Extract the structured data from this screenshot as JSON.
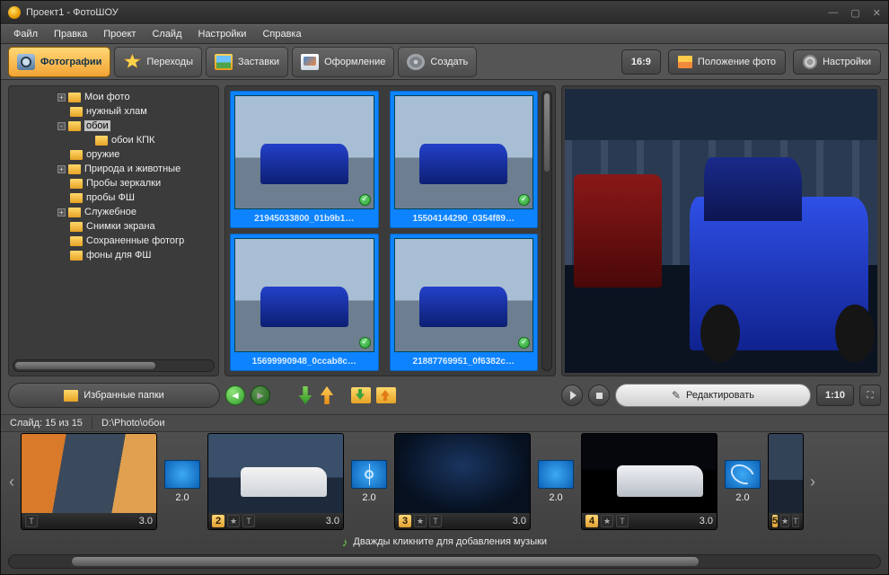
{
  "title": "Проект1 - ФотоШОУ",
  "menu": [
    "Файл",
    "Правка",
    "Проект",
    "Слайд",
    "Настройки",
    "Справка"
  ],
  "tabs": {
    "photos": "Фотографии",
    "transitions": "Переходы",
    "titles": "Заставки",
    "design": "Оформление",
    "create": "Создать"
  },
  "rtool": {
    "aspect": "16:9",
    "position": "Положение фото",
    "settings": "Настройки"
  },
  "tree": [
    {
      "indent": 50,
      "exp": "+",
      "label": "Мои фото"
    },
    {
      "indent": 50,
      "exp": "",
      "label": "нужный хлам"
    },
    {
      "indent": 50,
      "exp": "-",
      "label": "обои",
      "sel": true
    },
    {
      "indent": 78,
      "exp": "",
      "label": "обои КПК"
    },
    {
      "indent": 50,
      "exp": "",
      "label": "оружие"
    },
    {
      "indent": 50,
      "exp": "+",
      "label": "Природа и животные"
    },
    {
      "indent": 50,
      "exp": "",
      "label": "Пробы зеркалки"
    },
    {
      "indent": 50,
      "exp": "",
      "label": "пробы ФШ"
    },
    {
      "indent": 50,
      "exp": "+",
      "label": "Служебное"
    },
    {
      "indent": 50,
      "exp": "",
      "label": "Снимки экрана"
    },
    {
      "indent": 50,
      "exp": "",
      "label": "Сохраненные фотогр"
    },
    {
      "indent": 50,
      "exp": "",
      "label": "фоны для ФШ"
    }
  ],
  "thumbs": [
    "21945033800_01b9b1…",
    "15504144290_0354f89…",
    "15699990948_0ccab8c…",
    "21887769951_0f6382c…"
  ],
  "fav": "Избранные папки",
  "edit": "Редактировать",
  "time": "1:10",
  "status": {
    "slide": "Слайд: 15 из 15",
    "path": "D:\\Photo\\обои"
  },
  "timeline": {
    "slides": [
      {
        "num": "",
        "dur": "3.0",
        "cls": "s1",
        "showbar": false
      },
      {
        "num": "2",
        "dur": "3.0",
        "cls": "s2",
        "showbar": true
      },
      {
        "num": "3",
        "dur": "3.0",
        "cls": "s3",
        "showbar": true
      },
      {
        "num": "4",
        "dur": "3.0",
        "cls": "s4",
        "showbar": true
      },
      {
        "num": "5",
        "dur": "",
        "cls": "s5",
        "showbar": true
      }
    ],
    "trans": [
      {
        "dur": "2.0",
        "k": "plain"
      },
      {
        "dur": "2.0",
        "k": "target"
      },
      {
        "dur": "2.0",
        "k": "plain"
      },
      {
        "dur": "2.0",
        "k": "swirl"
      }
    ]
  },
  "music": "Дважды кликните для добавления музыки",
  "barT": "T"
}
